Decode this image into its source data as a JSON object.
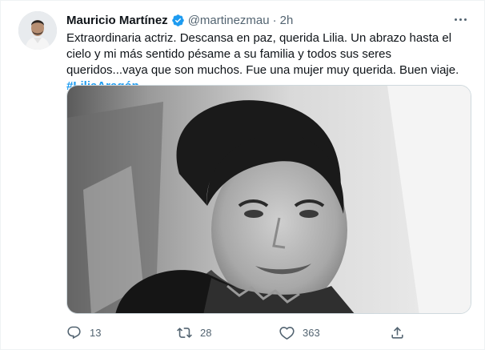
{
  "author": {
    "name": "Mauricio Martínez",
    "handle": "@martinezmau",
    "separator": "·",
    "time": "2h"
  },
  "tweet": {
    "text": "Extraordinaria actriz. Descansa en paz, querida Lilia. Un abrazo hasta el cielo y mi más sentido pésame a su familia y todos sus seres queridos...vaya que son muchos. Fue una mujer muy querida. Buen viaje. ",
    "hashtag": "#LiliaAragón"
  },
  "actions": {
    "reply_count": "13",
    "retweet_count": "28",
    "like_count": "363"
  },
  "icons": [
    "verified-badge-icon",
    "more-options-icon",
    "reply-icon",
    "retweet-icon",
    "like-icon",
    "share-icon"
  ],
  "colors": {
    "accent": "#1d9bf0",
    "text": "#0f1419",
    "muted": "#536471"
  }
}
